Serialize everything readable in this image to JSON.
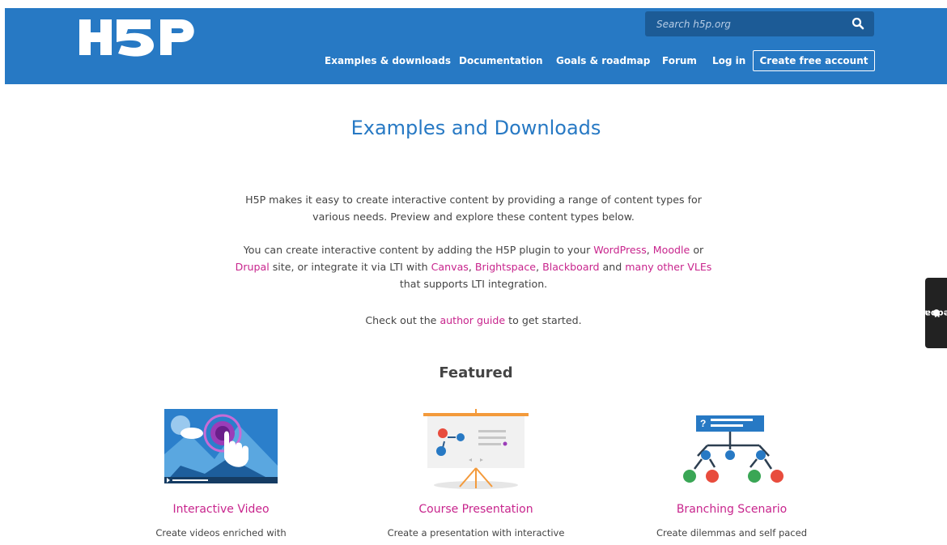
{
  "header": {
    "logo_text": "H5P",
    "search": {
      "placeholder": "Search h5p.org",
      "icon": "search-icon"
    },
    "nav": [
      {
        "label": "Examples & downloads"
      },
      {
        "label": "Documentation"
      },
      {
        "label": "Goals & roadmap"
      },
      {
        "label": "Forum"
      },
      {
        "label": "Log in"
      }
    ],
    "cta_label": "Create free account"
  },
  "main": {
    "title": "Examples and Downloads",
    "intro": "H5P makes it easy to create interactive content by providing a range of content types for various needs. Preview and explore these content types below.",
    "p2": {
      "t1": "You can create interactive content by adding the H5P plugin to your ",
      "wordpress": "WordPress",
      "comma1": ", ",
      "moodle": "Moodle",
      "t2": " or ",
      "drupal": "Drupal",
      "t3": " site, or integrate it via LTI with ",
      "canvas": "Canvas",
      "comma2": ", ",
      "brightspace": "Brightspace",
      "comma3": ", ",
      "blackboard": "Blackboard",
      "t4": " and ",
      "many": "many other VLEs",
      "t5": " that supports LTI integration."
    },
    "p3": {
      "t1": "Check out the ",
      "link": "author guide",
      "t2": " to get started."
    },
    "featured_heading": "Featured",
    "cards": [
      {
        "title": "Interactive Video",
        "desc": "Create videos enriched with",
        "icon": "interactive-video-icon"
      },
      {
        "title": "Course Presentation",
        "desc": "Create a presentation with interactive",
        "icon": "course-presentation-icon"
      },
      {
        "title": "Branching Scenario",
        "desc": "Create dilemmas and self paced",
        "icon": "branching-scenario-icon"
      }
    ]
  },
  "feedback_tab": {
    "label": "feedback",
    "icon": "comment-icon"
  },
  "colors": {
    "header_bg": "#2779c4",
    "search_bg": "#1c5b96",
    "title": "#2779c4",
    "link": "#c8258d",
    "text": "#444444"
  }
}
